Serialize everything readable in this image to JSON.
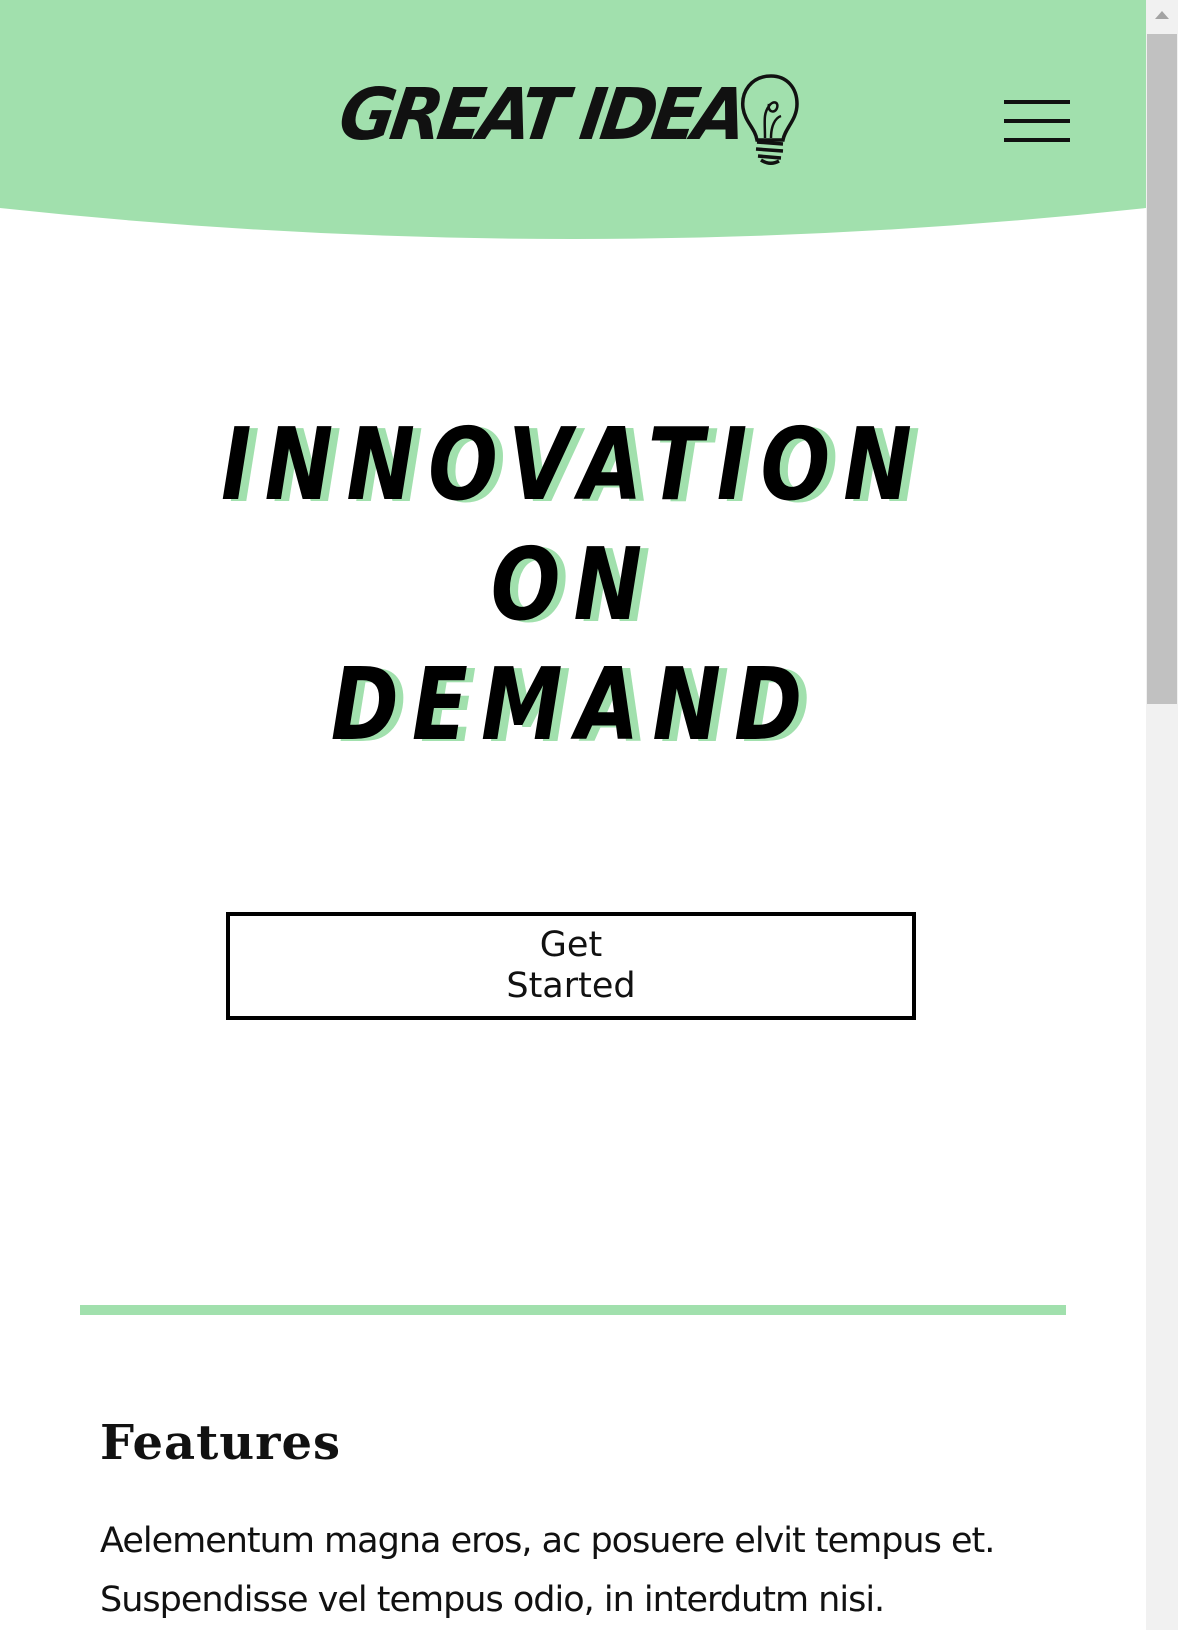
{
  "header": {
    "logo_text": "GREAT IDEA",
    "background_color": "#a1e0ad",
    "menu_icon": "hamburger-menu-icon",
    "logo_icon": "lightbulb-icon"
  },
  "hero": {
    "title_lines": [
      "INNOVATION",
      "ON",
      "DEMAND"
    ],
    "shadow_color": "#a1e0ad",
    "cta_label": "Get Started"
  },
  "features": {
    "title": "Features",
    "body": "Aelementum magna eros, ac posuere elvit tempus et. Suspendisse vel tempus odio, in interdutm nisi."
  },
  "scrollbar": {
    "up_icon": "scroll-up-arrow-icon"
  }
}
